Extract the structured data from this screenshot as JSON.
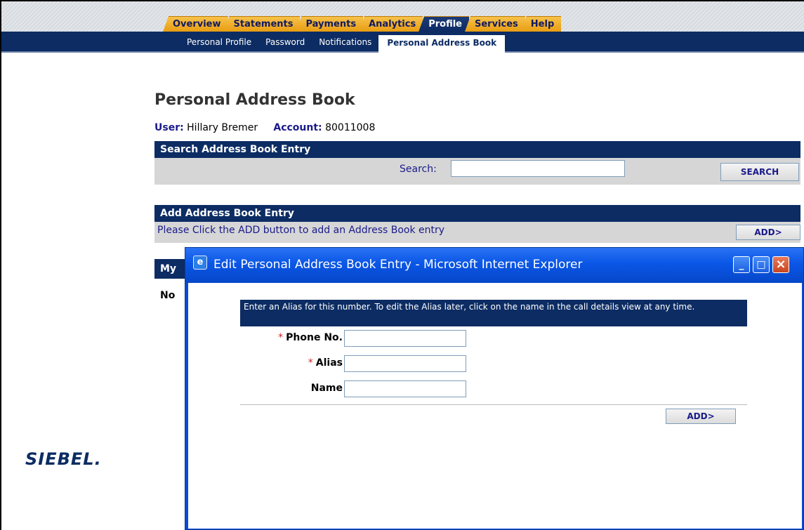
{
  "nav": {
    "tabs": [
      {
        "label": "Overview"
      },
      {
        "label": "Statements"
      },
      {
        "label": "Payments"
      },
      {
        "label": "Analytics"
      },
      {
        "label": "Profile"
      },
      {
        "label": "Services"
      },
      {
        "label": "Help"
      }
    ],
    "active_tab": "Profile",
    "subnav": [
      {
        "label": "Personal Profile"
      },
      {
        "label": "Password"
      },
      {
        "label": "Notifications"
      },
      {
        "label": "Personal Address Book"
      }
    ],
    "active_subnav": "Personal Address Book"
  },
  "page": {
    "title": "Personal Address Book",
    "user_label": "User:",
    "user_value": "Hillary Bremer",
    "account_label": "Account:",
    "account_value": "80011008"
  },
  "search_section": {
    "header": "Search Address Book Entry",
    "search_label": "Search:",
    "search_value": "",
    "search_button": "SEARCH"
  },
  "add_section": {
    "header": "Add Address Book Entry",
    "hint": "Please Click the ADD button to add an Address Book entry",
    "add_button": "ADD>"
  },
  "list_section": {
    "header_partial": "My",
    "empty_partial": "No"
  },
  "logo": {
    "text": "SIEBEL."
  },
  "popup": {
    "title": "Edit Personal Address Book Entry - Microsoft Internet Explorer",
    "instructions": "Enter an Alias for this number. To edit the Alias later, click on the name in the call details view at any time.",
    "fields": [
      {
        "label": "Phone No.",
        "required": "*",
        "value": ""
      },
      {
        "label": "Alias",
        "required": "*",
        "value": ""
      },
      {
        "label": "Name",
        "required": "",
        "value": ""
      }
    ],
    "add_button": "ADD>",
    "window_buttons": {
      "minimize": "_",
      "maximize": "□",
      "close": "×"
    },
    "icon_glyph": "e"
  },
  "colors": {
    "navy": "#0c2c63",
    "tab_orange": "#f0a820",
    "popup_blue": "#0a56e6",
    "required_red": "#cc2222",
    "section_gray": "#d6d6d6"
  }
}
